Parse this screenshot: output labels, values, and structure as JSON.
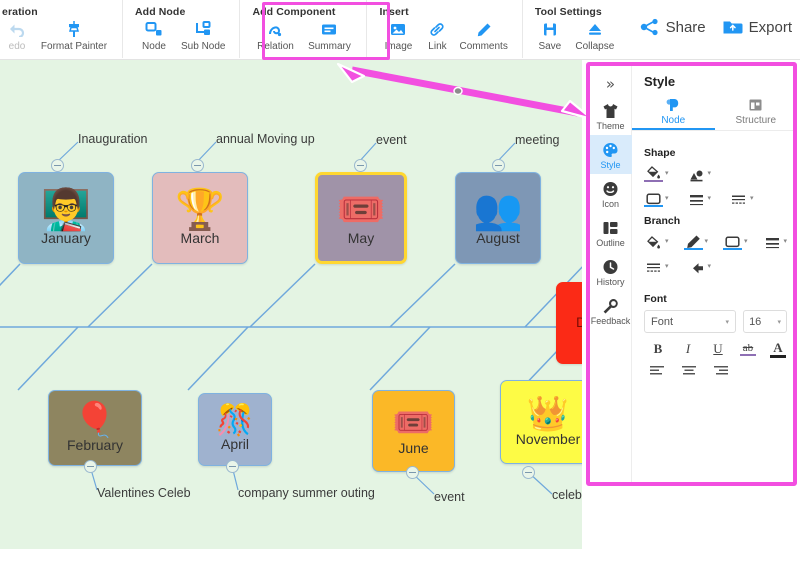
{
  "toolbar": {
    "groups": [
      {
        "title": "eration",
        "items": [
          {
            "label": "edo",
            "icon": "undo-icon",
            "disabled": true
          },
          {
            "label": "Format Painter",
            "icon": "format-painter-icon",
            "disabled": false
          }
        ]
      },
      {
        "title": "Add Node",
        "items": [
          {
            "label": "Node",
            "icon": "node-icon",
            "disabled": false
          },
          {
            "label": "Sub Node",
            "icon": "sub-node-icon",
            "disabled": false
          }
        ]
      },
      {
        "title": "Add Component",
        "items": [
          {
            "label": "Relation",
            "icon": "relation-icon",
            "disabled": false
          },
          {
            "label": "Summary",
            "icon": "summary-icon",
            "disabled": false
          }
        ]
      },
      {
        "title": "Insert",
        "highlighted": true,
        "items": [
          {
            "label": "Image",
            "icon": "image-icon",
            "disabled": false
          },
          {
            "label": "Link",
            "icon": "link-icon",
            "disabled": false
          },
          {
            "label": "Comments",
            "icon": "comments-icon",
            "disabled": false
          }
        ]
      },
      {
        "title": "Tool Settings",
        "items": [
          {
            "label": "Save",
            "icon": "save-icon",
            "disabled": false
          },
          {
            "label": "Collapse",
            "icon": "collapse-icon",
            "disabled": false
          }
        ]
      }
    ],
    "right_actions": [
      {
        "label": "Share",
        "icon": "share-icon"
      },
      {
        "label": "Export",
        "icon": "export-icon"
      }
    ]
  },
  "canvas": {
    "background_color": "#e4f4e3",
    "link_color": "#6fa8dc",
    "nodes": [
      {
        "label": "January",
        "glyph": "👨‍🏫",
        "fill": "#8fb4c4",
        "selected": false,
        "branch_label": "Inauguration"
      },
      {
        "label": "March",
        "glyph": "🏆",
        "fill": "#e3bcbc",
        "selected": false,
        "branch_label": "annual Moving up"
      },
      {
        "label": "May",
        "glyph": "🎟️",
        "fill": "#a093a8",
        "selected": true,
        "branch_label": "event"
      },
      {
        "label": "August",
        "glyph": "👥",
        "fill": "#7e97b5",
        "selected": false,
        "branch_label": "meeting"
      },
      {
        "label": "February",
        "glyph": "🎈",
        "fill": "#8e8560",
        "selected": false,
        "branch_label": "Valentines Celeb"
      },
      {
        "label": "April",
        "glyph": "🎊",
        "fill": "#9fb2cf",
        "selected": false,
        "branch_label": "company summer outing"
      },
      {
        "label": "June",
        "glyph": "🎟️",
        "fill": "#fbb827",
        "selected": false,
        "branch_label": "event"
      },
      {
        "label": "November",
        "glyph": "👑",
        "fill": "#fdfb45",
        "selected": false,
        "branch_label": "celeb"
      }
    ],
    "hidden_node": {
      "label": "D",
      "fill": "#fb2a16"
    }
  },
  "annotation": {
    "type": "double-arrow",
    "color": "#f24fe0"
  },
  "panel": {
    "collapse_glyph": "»",
    "title": "Style",
    "rail": [
      {
        "label": "Theme",
        "icon": "tshirt-icon",
        "active": false
      },
      {
        "label": "Style",
        "icon": "palette-icon",
        "active": true
      },
      {
        "label": "Icon",
        "icon": "smiley-icon",
        "active": false
      },
      {
        "label": "Outline",
        "icon": "outline-icon",
        "active": false
      },
      {
        "label": "History",
        "icon": "clock-icon",
        "active": false
      },
      {
        "label": "Feedback",
        "icon": "wrench-icon",
        "active": false
      }
    ],
    "tabs": [
      {
        "label": "Node",
        "icon": "node-shape-icon",
        "active": true
      },
      {
        "label": "Structure",
        "icon": "structure-icon",
        "active": false
      }
    ],
    "sections": [
      {
        "title": "Shape",
        "rows": [
          [
            {
              "icon": "fill-color-icon",
              "underline": "#8e6fb4"
            },
            {
              "icon": "shape-style-icon",
              "underline": ""
            }
          ],
          [
            {
              "icon": "border-shape-icon",
              "underline": "#2196f3"
            },
            {
              "icon": "line-weight-icon",
              "underline": ""
            },
            {
              "icon": "line-dash-icon",
              "underline": ""
            }
          ]
        ]
      },
      {
        "title": "Branch",
        "rows": [
          [
            {
              "icon": "fill-color-icon",
              "underline": ""
            },
            {
              "icon": "pen-color-icon",
              "underline": "#2196f3"
            },
            {
              "icon": "branch-shape-icon",
              "underline": "#2196f3"
            },
            {
              "icon": "line-weight-icon",
              "underline": ""
            }
          ],
          [
            {
              "icon": "line-dash-icon",
              "underline": ""
            },
            {
              "icon": "arrow-style-icon",
              "underline": ""
            }
          ]
        ]
      }
    ],
    "font": {
      "title": "Font",
      "family_value": "Font",
      "size_value": "16",
      "format_buttons": [
        {
          "label": "B",
          "name": "bold-button"
        },
        {
          "label": "I",
          "name": "italic-button"
        },
        {
          "label": "U",
          "name": "underline-button"
        },
        {
          "label": "ab",
          "name": "strikethrough-button"
        },
        {
          "label": "A",
          "name": "font-color-button"
        }
      ],
      "align_buttons": [
        {
          "name": "align-left-button"
        },
        {
          "name": "align-center-button"
        },
        {
          "name": "align-right-button"
        }
      ]
    }
  },
  "accent_colors": {
    "brand_blue": "#2196f3",
    "highlight_pink": "#f24fe0",
    "selection_yellow": "#ffd730"
  }
}
